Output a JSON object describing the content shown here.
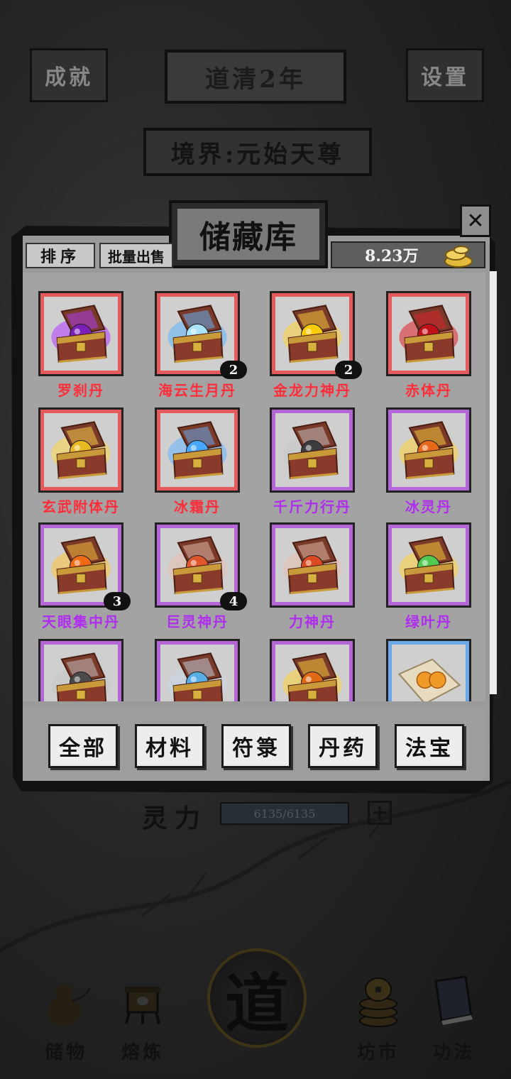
{
  "header": {
    "achievements_label": "成就",
    "settings_label": "设置",
    "year_label": "道清2年",
    "realm_label": "境界:元始天尊"
  },
  "storage": {
    "title": "储藏库",
    "sort_label": "排序",
    "bulk_sell_label": "批量出售",
    "currency_amount": "8.23万",
    "items": [
      {
        "name": "罗刹丹",
        "count": "",
        "frame": "#e55a5a",
        "name_color": "#ff2d3a",
        "orb": "#7a1fb8",
        "glow": "#b23cff",
        "kind": "chest"
      },
      {
        "name": "海云生月丹",
        "count": "2",
        "frame": "#e55a5a",
        "name_color": "#ff2d3a",
        "orb": "#a9e4ff",
        "glow": "#5fb7ff",
        "kind": "chest"
      },
      {
        "name": "金龙力神丹",
        "count": "2",
        "frame": "#e55a5a",
        "name_color": "#ff2d3a",
        "orb": "#ffcc00",
        "glow": "#ffd23a",
        "kind": "chest"
      },
      {
        "name": "赤体丹",
        "count": "",
        "frame": "#e55a5a",
        "name_color": "#ff2d3a",
        "orb": "#c0101a",
        "glow": "#e0202a",
        "kind": "chest"
      },
      {
        "name": "玄武附体丹",
        "count": "",
        "frame": "#e55a5a",
        "name_color": "#ff2d3a",
        "orb": "#e8b820",
        "glow": "#ffd84a",
        "kind": "chest"
      },
      {
        "name": "冰霜丹",
        "count": "",
        "frame": "#e55a5a",
        "name_color": "#ff2d3a",
        "orb": "#49a7ff",
        "glow": "#64b4ff",
        "kind": "chest"
      },
      {
        "name": "千斤力行丹",
        "count": "",
        "frame": "#b566d6",
        "name_color": "#b02df0",
        "orb": "#3c3c3c",
        "glow": "#c8c8c8",
        "kind": "chest"
      },
      {
        "name": "冰灵丹",
        "count": "",
        "frame": "#b566d6",
        "name_color": "#b02df0",
        "orb": "#e76a1a",
        "glow": "#ffd23a",
        "kind": "chest"
      },
      {
        "name": "天眼集中丹",
        "count": "3",
        "frame": "#b566d6",
        "name_color": "#b02df0",
        "orb": "#f06a14",
        "glow": "#ffc53a",
        "kind": "chest"
      },
      {
        "name": "巨灵神丹",
        "count": "4",
        "frame": "#b566d6",
        "name_color": "#b02df0",
        "orb": "#e0562c",
        "glow": "#e8c0b0",
        "kind": "chest"
      },
      {
        "name": "力神丹",
        "count": "",
        "frame": "#b566d6",
        "name_color": "#b02df0",
        "orb": "#dd4a22",
        "glow": "#e8c0b0",
        "kind": "chest"
      },
      {
        "name": "绿叶丹",
        "count": "",
        "frame": "#b566d6",
        "name_color": "#b02df0",
        "orb": "#4fc94f",
        "glow": "#ffd23a",
        "kind": "chest"
      },
      {
        "name": "",
        "count": "",
        "frame": "#b566d6",
        "name_color": "#b02df0",
        "orb": "#4a4a4a",
        "glow": "#c8c8c8",
        "kind": "chest"
      },
      {
        "name": "",
        "count": "",
        "frame": "#b566d6",
        "name_color": "#b02df0",
        "orb": "#5aaee8",
        "glow": "#c8d8e8",
        "kind": "chest"
      },
      {
        "name": "",
        "count": "",
        "frame": "#b566d6",
        "name_color": "#b02df0",
        "orb": "#e06a14",
        "glow": "#ffd23a",
        "kind": "chest"
      },
      {
        "name": "",
        "count": "",
        "frame": "#6aa8e8",
        "name_color": "#2a6ad0",
        "orb": "#f09a2a",
        "glow": "#e8dcc0",
        "kind": "scroll"
      }
    ],
    "filters": [
      "全部",
      "材料",
      "符箓",
      "丹药",
      "法宝"
    ]
  },
  "status": {
    "spirit_label": "灵力",
    "spirit_value": "6135/6135",
    "plus_label": "+"
  },
  "nav": {
    "items": [
      {
        "label": "储物",
        "icon": "gourd-icon"
      },
      {
        "label": "熔炼",
        "icon": "furnace-icon"
      },
      {
        "label": "道",
        "icon": "dao-icon"
      },
      {
        "label": "坊市",
        "icon": "coins-icon"
      },
      {
        "label": "功法",
        "icon": "book-icon"
      }
    ]
  }
}
